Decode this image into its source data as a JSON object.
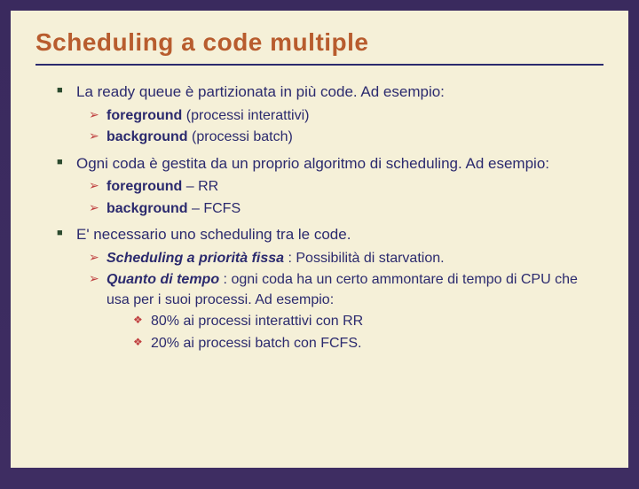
{
  "title": "Scheduling a code multiple",
  "p1": "La ready queue è partizionata in più code. Ad esempio:",
  "p1a_b": "foreground",
  "p1a_t": " (processi interattivi)",
  "p1b_b": "background",
  "p1b_t": " (processi batch)",
  "p2": "Ogni coda è gestita da un proprio algoritmo di scheduling. Ad esempio:",
  "p2a_b": "foreground",
  "p2a_t": " – RR",
  "p2b_b": "background",
  "p2b_t": " – FCFS",
  "p3": "E' necessario uno scheduling tra le code.",
  "p3a_bi": "Scheduling a priorità fissa",
  "p3a_t": " : Possibilità di starvation.",
  "p3b_bi": "Quanto di tempo",
  "p3b_t": " : ogni coda ha un certo ammontare di tempo di CPU che usa per i suoi processi. Ad esempio:",
  "p3b1": "80% ai processi interattivi con RR",
  "p3b2": "20% ai processi batch con FCFS."
}
